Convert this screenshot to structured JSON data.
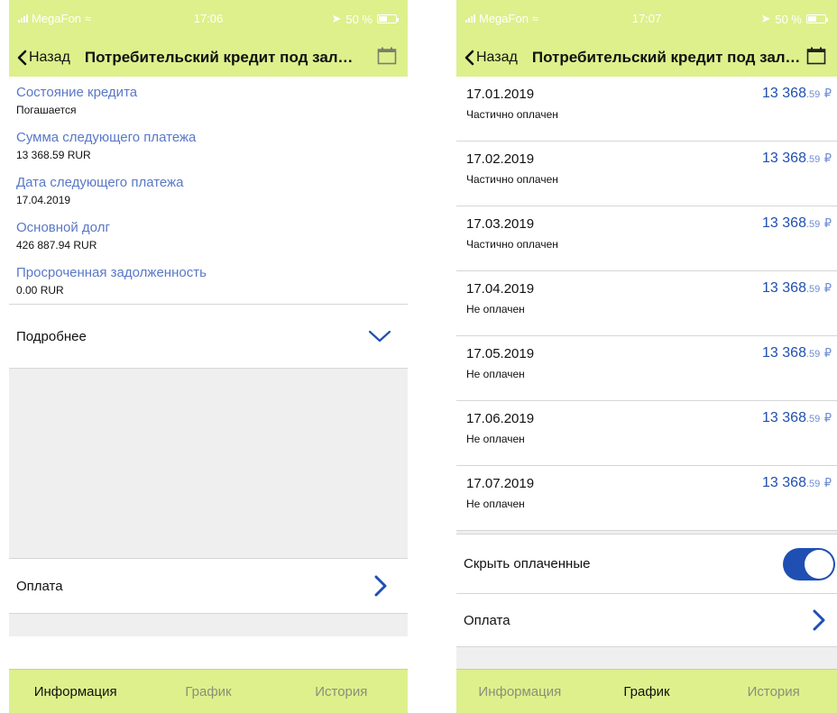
{
  "left": {
    "status_bar": {
      "carrier": "MegaFon",
      "time": "17:06",
      "battery": "50 %",
      "battery_level": 0.5
    },
    "nav": {
      "back_label": "Назад",
      "title": "Потребительский кредит под залог..."
    },
    "fields": [
      {
        "label": "Состояние кредита",
        "value": "Погашается"
      },
      {
        "label": "Сумма следующего платежа",
        "value": "13 368.59 RUR"
      },
      {
        "label": "Дата следующего платежа",
        "value": "17.04.2019"
      },
      {
        "label": "Основной долг",
        "value": "426 887.94 RUR"
      },
      {
        "label": "Просроченная задолженность",
        "value": "0.00 RUR"
      }
    ],
    "details_label": "Подробнее",
    "payment_label": "Оплата",
    "tabs": {
      "info": "Информация",
      "schedule": "График",
      "history": "История"
    },
    "active_tab": "info"
  },
  "right": {
    "status_bar": {
      "carrier": "MegaFon",
      "time": "17:07",
      "battery": "50 %",
      "battery_level": 0.5
    },
    "nav": {
      "back_label": "Назад",
      "title": "Потребительский кредит под залог..."
    },
    "schedule": [
      {
        "date": "17.01.2019",
        "status": "Частично оплачен",
        "amount_main": "13 368",
        "amount_cents": ".59",
        "currency": "₽"
      },
      {
        "date": "17.02.2019",
        "status": "Частично оплачен",
        "amount_main": "13 368",
        "amount_cents": ".59",
        "currency": "₽"
      },
      {
        "date": "17.03.2019",
        "status": "Частично оплачен",
        "amount_main": "13 368",
        "amount_cents": ".59",
        "currency": "₽"
      },
      {
        "date": "17.04.2019",
        "status": "Не оплачен",
        "amount_main": "13 368",
        "amount_cents": ".59",
        "currency": "₽"
      },
      {
        "date": "17.05.2019",
        "status": "Не оплачен",
        "amount_main": "13 368",
        "amount_cents": ".59",
        "currency": "₽"
      },
      {
        "date": "17.06.2019",
        "status": "Не оплачен",
        "amount_main": "13 368",
        "amount_cents": ".59",
        "currency": "₽"
      },
      {
        "date": "17.07.2019",
        "status": "Не оплачен",
        "amount_main": "13 368",
        "amount_cents": ".59",
        "currency": "₽"
      }
    ],
    "hide_paid_label": "Скрыть оплаченные",
    "hide_paid_on": true,
    "payment_label": "Оплата",
    "tabs": {
      "info": "Информация",
      "schedule": "График",
      "history": "История"
    },
    "active_tab": "schedule"
  },
  "colors": {
    "header_bg": "#ddf08c",
    "accent_blue": "#1f4fb2",
    "label_blue": "#5a78c7"
  }
}
